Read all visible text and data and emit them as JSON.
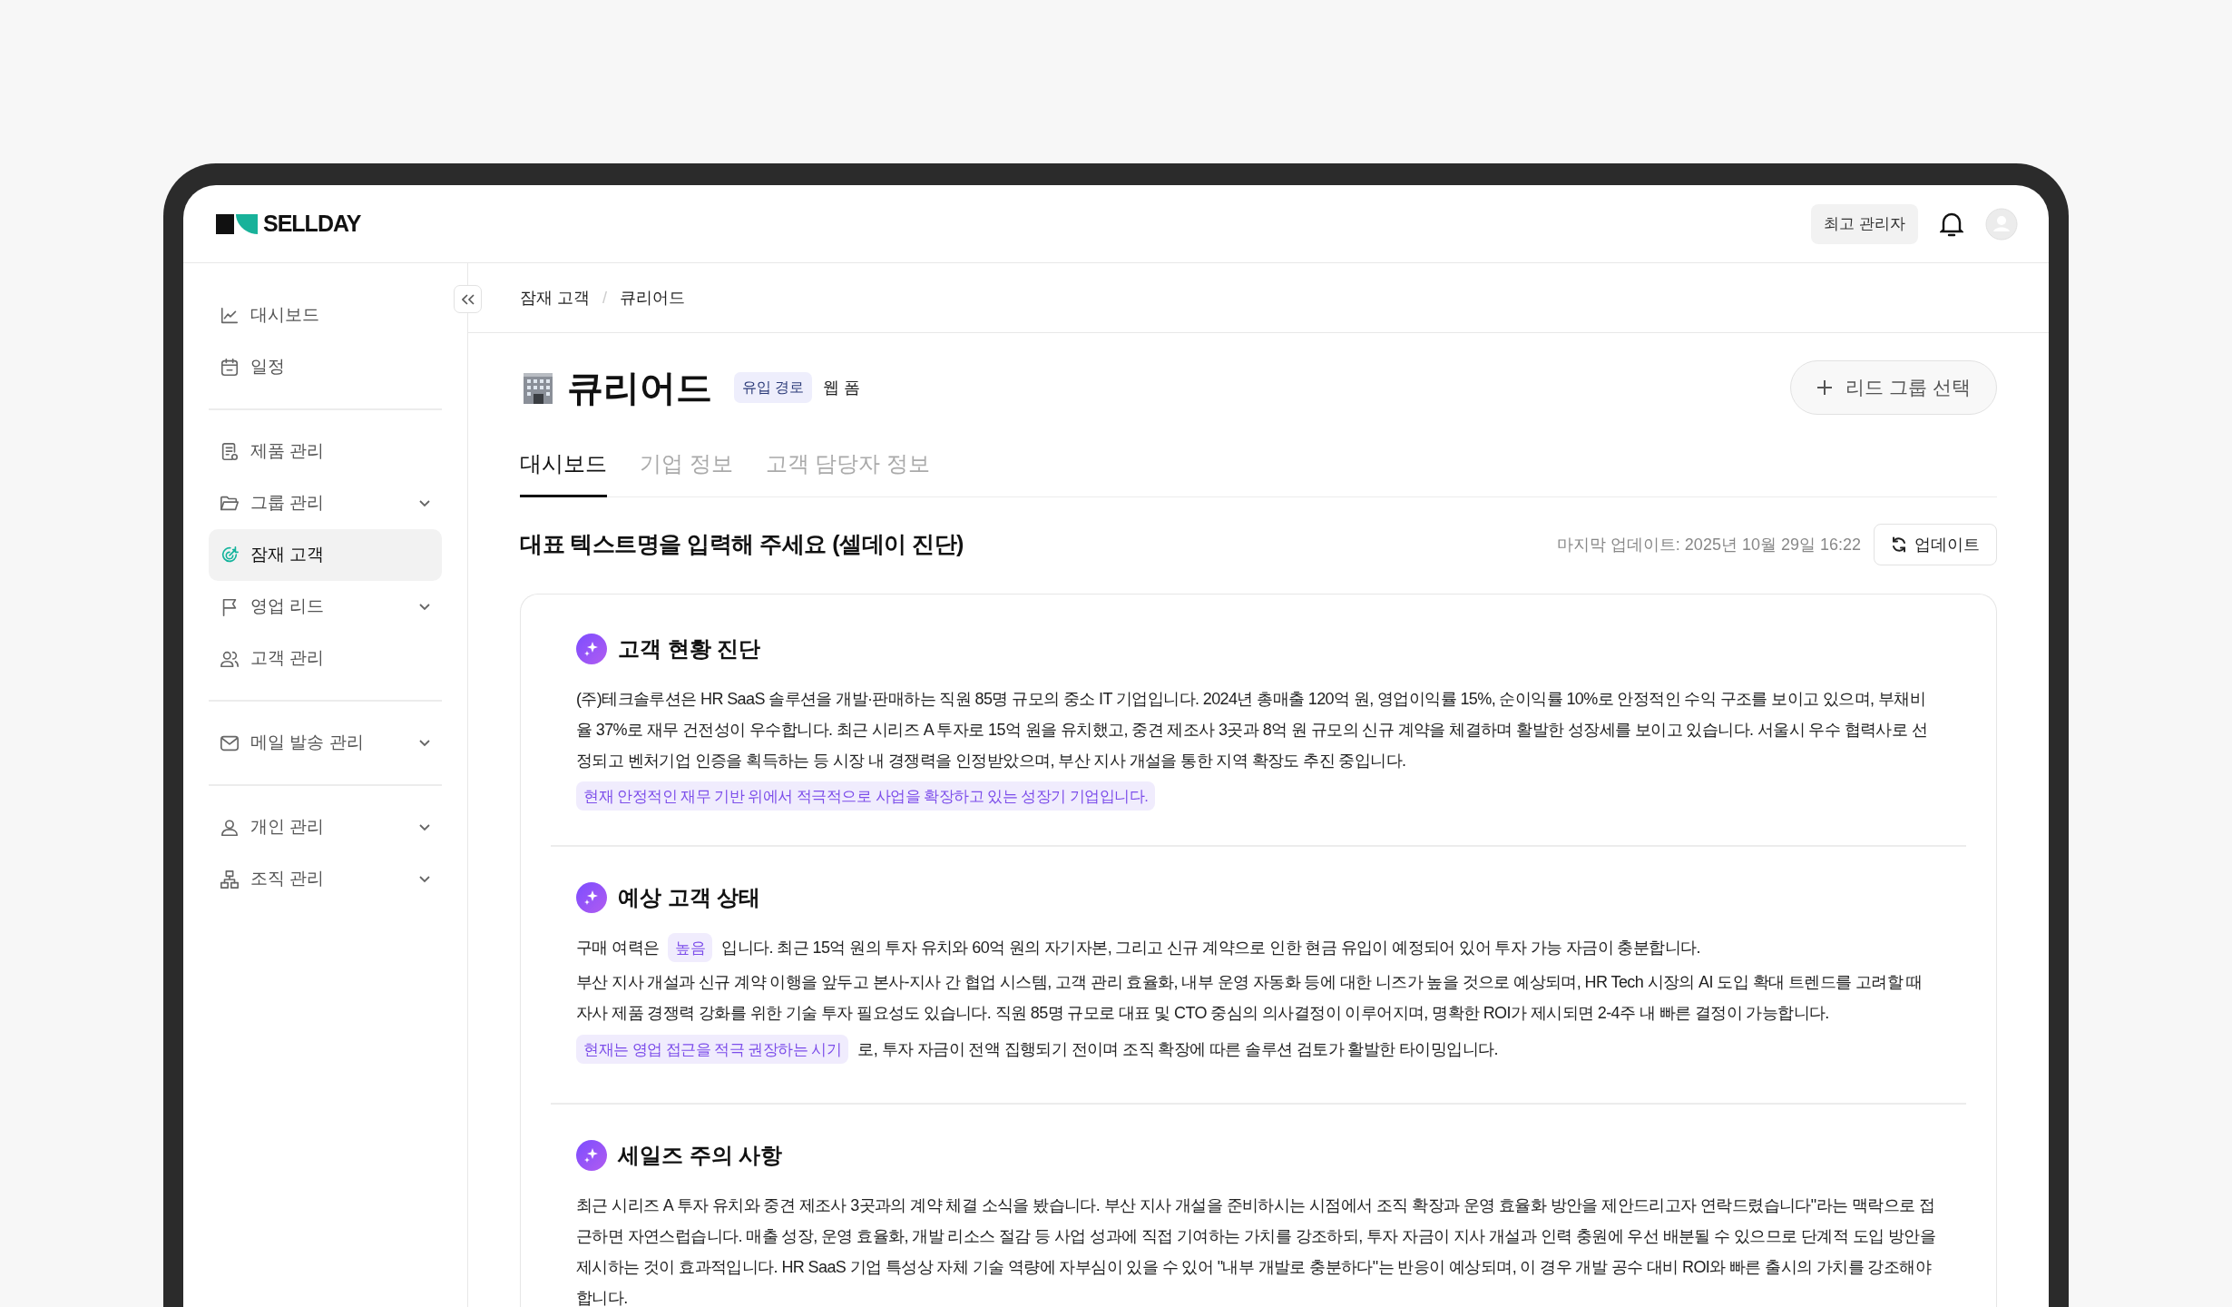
{
  "header": {
    "logo": "SELLDAY",
    "role_badge": "최고 관리자"
  },
  "sidebar": {
    "groups": [
      [
        {
          "label": "대시보드",
          "selected": false,
          "expandable": false
        },
        {
          "label": "일정",
          "selected": false,
          "expandable": false
        }
      ],
      [
        {
          "label": "제품 관리",
          "selected": false,
          "expandable": false
        },
        {
          "label": "그룹 관리",
          "selected": false,
          "expandable": true
        },
        {
          "label": "잠재 고객",
          "selected": true,
          "expandable": false
        },
        {
          "label": "영업 리드",
          "selected": false,
          "expandable": true
        },
        {
          "label": "고객 관리",
          "selected": false,
          "expandable": false
        }
      ],
      [
        {
          "label": "메일 발송 관리",
          "selected": false,
          "expandable": true
        }
      ],
      [
        {
          "label": "개인 관리",
          "selected": false,
          "expandable": true
        },
        {
          "label": "조직 관리",
          "selected": false,
          "expandable": true
        }
      ]
    ]
  },
  "breadcrumb": {
    "items": [
      "잠재 고객",
      "큐리어드"
    ],
    "separator": "/"
  },
  "title": {
    "name": "큐리어드",
    "tag": "유입 경로",
    "tag_value": "웹 폼",
    "action": "리드 그룹 선택"
  },
  "tabs": [
    {
      "label": "대시보드",
      "selected": true
    },
    {
      "label": "기업 정보",
      "selected": false
    },
    {
      "label": "고객 담당자 정보",
      "selected": false
    }
  ],
  "report": {
    "title": "대표 텍스트명을 입력해 주세요 (셀데이 진단)",
    "last_update": "마지막 업데이트: 2025년 10월 29일 16:22",
    "update_button": "업데이트"
  },
  "sections": [
    {
      "title": "고객 현황 진단",
      "blocks": [
        {
          "kind": "paragraph",
          "text": "(주)테크솔루션은 HR SaaS 솔루션을 개발·판매하는 직원 85명 규모의 중소 IT 기업입니다. 2024년 총매출 120억 원, 영업이익률 15%, 순이익률 10%로 안정적인 수익 구조를 보이고 있으며, 부채비율 37%로 재무 건전성이 우수합니다. 최근 시리즈 A 투자로 15억 원을 유치했고, 중견 제조사 3곳과 8억 원 규모의 신규 계약을 체결하며 활발한 성장세를 보이고 있습니다. 서울시 우수 협력사로 선정되고 벤처기업 인증을 획득하는 등 시장 내 경쟁력을 인정받았으며, 부산 지사 개설을 통한 지역 확장도 추진 중입니다."
        },
        {
          "kind": "highlight",
          "text": "현재 안정적인 재무 기반 위에서 적극적으로 사업을 확장하고 있는 성장기 기업입니다."
        }
      ]
    },
    {
      "title": "예상 고객 상태",
      "blocks": [
        {
          "kind": "line",
          "parts": [
            {
              "text": "구매 여력은",
              "highlight": false
            },
            {
              "text": "높음",
              "highlight": true
            },
            {
              "text": "입니다. 최근 15억 원의 투자 유치와 60억 원의 자기자본, 그리고 신규 계약으로 인한 현금 유입이 예정되어 있어 투자 가능 자금이 충분합니다.",
              "highlight": false
            }
          ]
        },
        {
          "kind": "paragraph",
          "text": "부산 지사 개설과 신규 계약 이행을 앞두고 본사-지사 간 협업 시스템, 고객 관리 효율화, 내부 운영 자동화 등에 대한 니즈가 높을 것으로 예상되며, HR Tech 시장의 AI 도입 확대 트렌드를 고려할 때 자사 제품 경쟁력 강화를 위한 기술 투자 필요성도 있습니다. 직원 85명 규모로 대표 및 CTO 중심의 의사결정이 이루어지며, 명확한 ROI가 제시되면 2-4주 내 빠른 결정이 가능합니다."
        },
        {
          "kind": "line",
          "parts": [
            {
              "text": "현재는 영업 접근을 적극 권장하는 시기",
              "highlight": true
            },
            {
              "text": "로, 투자 자금이 전액 집행되기 전이며 조직 확장에 따른 솔루션 검토가 활발한 타이밍입니다.",
              "highlight": false
            }
          ]
        }
      ]
    },
    {
      "title": "세일즈 주의 사항",
      "blocks": [
        {
          "kind": "paragraph",
          "text": "최근 시리즈 A 투자 유치와 중견 제조사 3곳과의 계약 체결 소식을 봤습니다. 부산 지사 개설을 준비하시는 시점에서 조직 확장과 운영 효율화 방안을 제안드리고자 연락드렸습니다\"라는 맥락으로 접근하면 자연스럽습니다. 매출 성장, 운영 효율화, 개발 리소스 절감 등 사업 성과에 직접 기여하는 가치를 강조하되, 투자 자금이 지사 개설과 인력 충원에 우선 배분될 수 있으므로 단계적 도입 방안을 제시하는 것이 효과적입니다. HR SaaS 기업 특성상 자체 기술 역량에 자부심이 있을 수 있어 \"내부 개발로 충분하다\"는 반응이 예상되며, 이 경우 개발 공수 대비 ROI와 빠른 출시의 가치를 강조해야 합니다."
        }
      ]
    }
  ]
}
